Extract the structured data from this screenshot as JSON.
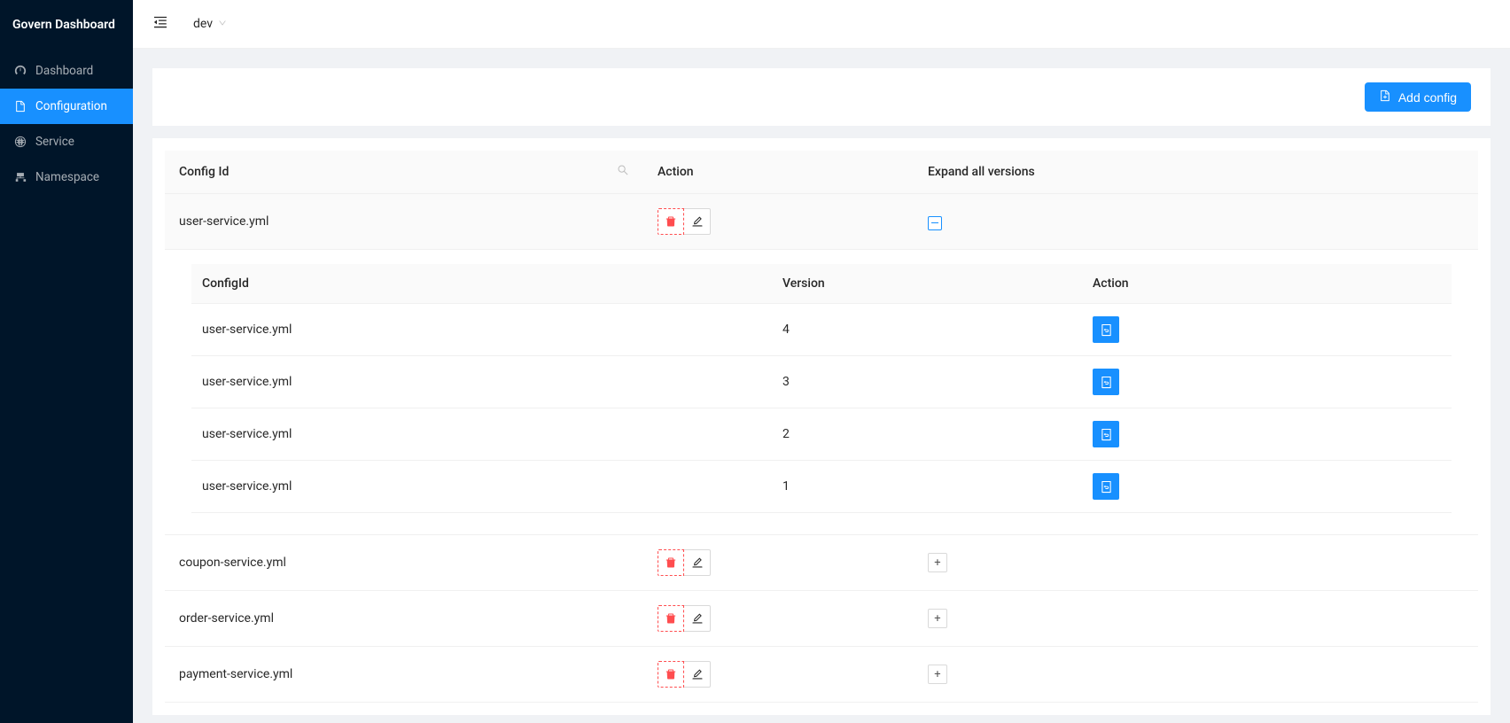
{
  "app_title": "Govern Dashboard",
  "sidebar": {
    "items": [
      {
        "label": "Dashboard"
      },
      {
        "label": "Configuration"
      },
      {
        "label": "Service"
      },
      {
        "label": "Namespace"
      }
    ]
  },
  "header": {
    "env": "dev"
  },
  "toolbar": {
    "add_config_label": "Add config"
  },
  "table": {
    "columns": {
      "config_id": "Config Id",
      "action": "Action",
      "expand": "Expand all versions"
    },
    "rows": [
      {
        "config_id": "user-service.yml",
        "expanded": true
      },
      {
        "config_id": "coupon-service.yml",
        "expanded": false
      },
      {
        "config_id": "order-service.yml",
        "expanded": false
      },
      {
        "config_id": "payment-service.yml",
        "expanded": false
      }
    ],
    "nested": {
      "columns": {
        "config_id": "ConfigId",
        "version": "Version",
        "action": "Action"
      },
      "rows": [
        {
          "config_id": "user-service.yml",
          "version": "4"
        },
        {
          "config_id": "user-service.yml",
          "version": "3"
        },
        {
          "config_id": "user-service.yml",
          "version": "2"
        },
        {
          "config_id": "user-service.yml",
          "version": "1"
        }
      ]
    }
  }
}
